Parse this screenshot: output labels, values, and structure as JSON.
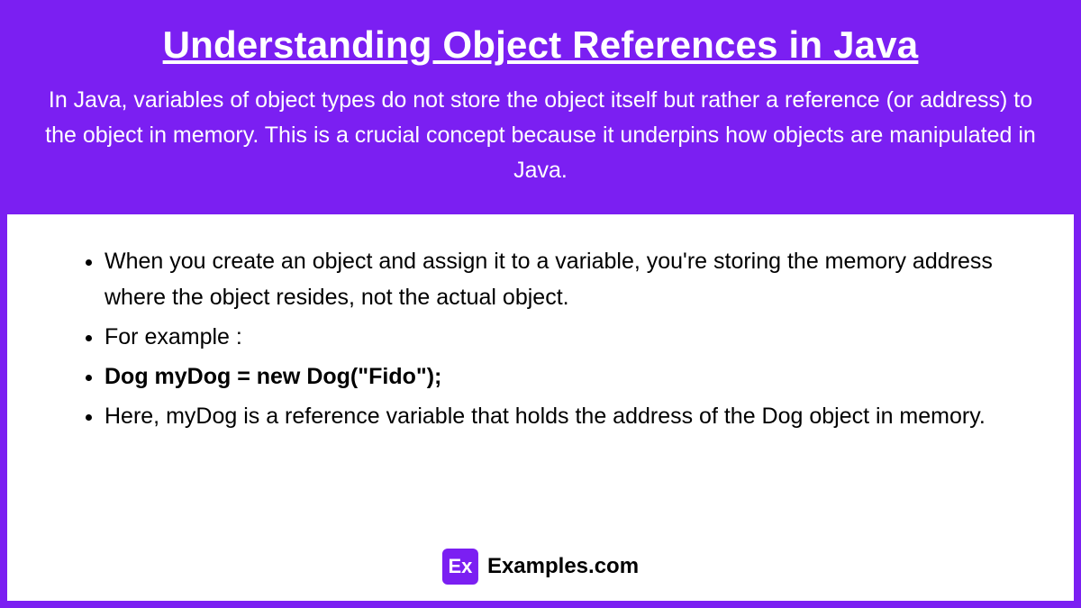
{
  "header": {
    "title": "Understanding Object References in Java",
    "intro": "In Java, variables of object types do not store the object itself but rather a reference (or address) to the object in memory. This is a crucial concept because it underpins how objects are manipulated in Java."
  },
  "content": {
    "bullets": [
      "When you create an object and assign it to a variable, you're storing the memory address where the object resides, not the actual object.",
      "For example :",
      "Dog myDog = new Dog(\"Fido\");",
      "Here, myDog is a reference variable that holds the address of the Dog object in memory."
    ]
  },
  "footer": {
    "brand_icon_text": "Ex",
    "brand_name": "Examples.com"
  }
}
